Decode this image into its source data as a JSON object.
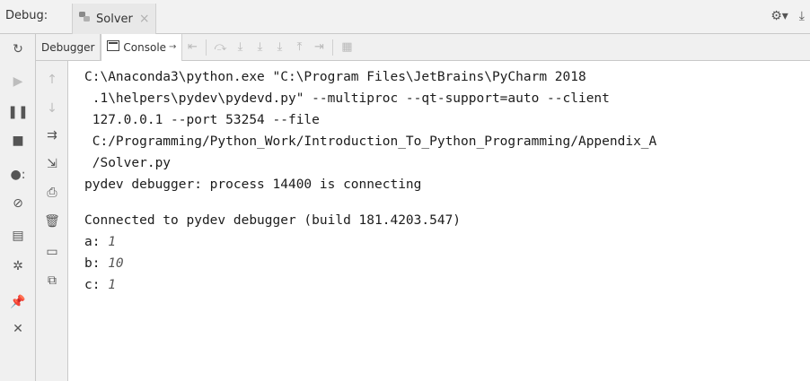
{
  "titlebar": {
    "debug_label": "Debug:",
    "tab_label": "Solver",
    "close_glyph": "×"
  },
  "toolbar": {
    "debugger_tab": "Debugger",
    "console_tab": "Console",
    "console_pin": "→"
  },
  "console": {
    "lines": [
      "C:\\Anaconda3\\python.exe \"C:\\Program Files\\JetBrains\\PyCharm 2018",
      " .1\\helpers\\pydev\\pydevd.py\" --multiproc --qt-support=auto --client",
      " 127.0.0.1 --port 53254 --file",
      " C:/Programming/Python_Work/Introduction_To_Python_Programming/Appendix_A",
      " /Solver.py",
      "pydev debugger: process 14400 is connecting",
      "",
      "Connected to pydev debugger (build 181.4203.547)"
    ],
    "vars": [
      {
        "name": "a:",
        "value": "1"
      },
      {
        "name": "b:",
        "value": "10"
      },
      {
        "name": "c:",
        "value": "1"
      }
    ]
  }
}
